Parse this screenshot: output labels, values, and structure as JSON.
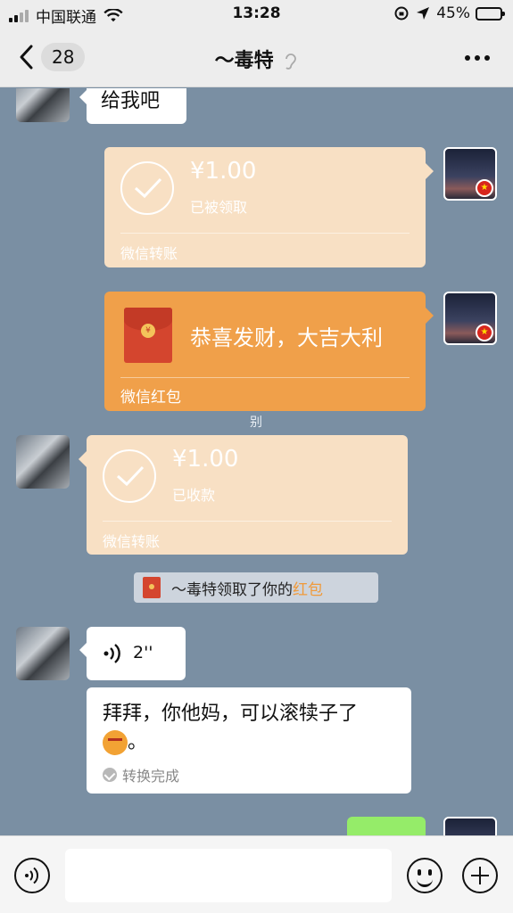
{
  "status_bar": {
    "carrier": "中国联通",
    "time": "13:28",
    "battery": "45%",
    "battery_level": 0.45
  },
  "nav": {
    "unread_count": "28",
    "title": "～毒特"
  },
  "messages": {
    "text1": "给我吧",
    "transfer_sent": {
      "amount": "¥1.00",
      "status": "已被领取",
      "label": "微信转账"
    },
    "red_packet": {
      "text": "恭喜发财，大吉大利",
      "label": "微信红包",
      "seal": "¥"
    },
    "ghost": "别",
    "transfer_received": {
      "amount": "¥1.00",
      "status": "已收款",
      "label": "微信转账"
    },
    "system": {
      "prefix": "～毒特领取了你的",
      "highlight": "红包"
    },
    "voice": {
      "duration": "2''"
    },
    "stt": {
      "text": "拜拜，你他妈，可以滚犊子了",
      "suffix": "。",
      "status": "转换完成"
    }
  },
  "colors": {
    "chat_bg": "#7a8fa3",
    "transfer_bg": "#f8e0c4",
    "red_packet_bg": "#f0a04a",
    "highlight": "#f09a3a",
    "my_bubble": "#95ec69"
  }
}
